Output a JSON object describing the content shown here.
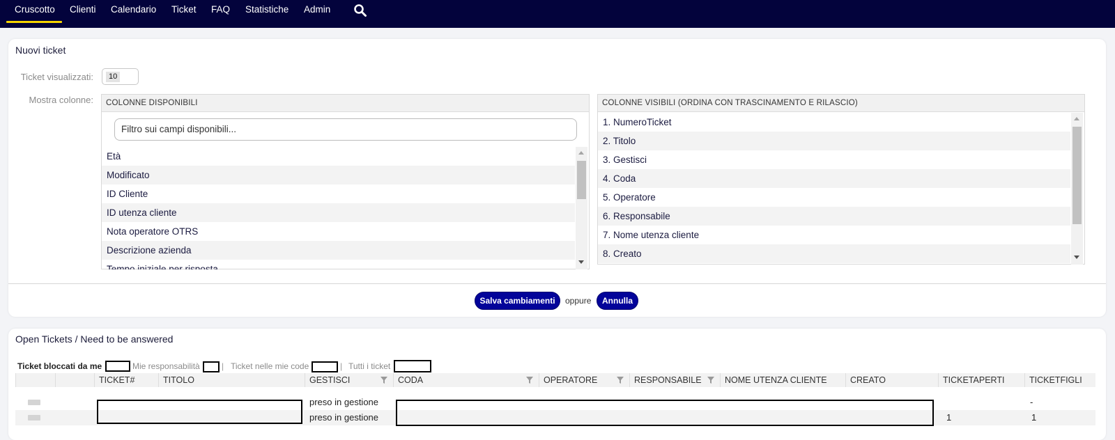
{
  "nav": {
    "items": [
      {
        "label": "Cruscotto",
        "active": true
      },
      {
        "label": "Clienti"
      },
      {
        "label": "Calendario"
      },
      {
        "label": "Ticket"
      },
      {
        "label": "FAQ"
      },
      {
        "label": "Statistiche"
      },
      {
        "label": "Admin"
      }
    ],
    "search_icon": "search-icon"
  },
  "new_tickets": {
    "title": "Nuovi ticket",
    "shown_label": "Ticket visualizzati:",
    "shown_value": "10",
    "columns_label": "Mostra colonne:",
    "available": {
      "header": "COLONNE DISPONIBILI",
      "filter_placeholder": "Filtro sui campi disponibili...",
      "items": [
        "Età",
        "Modificato",
        "ID Cliente",
        "ID utenza cliente",
        "Nota operatore OTRS",
        "Descrizione azienda",
        "Tempo iniziale per risposta"
      ]
    },
    "visible": {
      "header": "COLONNE VISIBILI (ORDINA CON TRASCINAMENTO E RILASCIO)",
      "items": [
        "1. NumeroTicket",
        "2. Titolo",
        "3. Gestisci",
        "4. Coda",
        "5. Operatore",
        "6. Responsabile",
        "7. Nome utenza cliente",
        "8. Creato"
      ]
    },
    "save_label": "Salva cambiamenti",
    "or_label": "oppure",
    "cancel_label": "Annulla"
  },
  "open_tickets": {
    "title": "Open Tickets / Need to be answered",
    "filters": [
      {
        "label": "Ticket bloccati da me",
        "active": true
      },
      {
        "label": "Mie responsabilità"
      },
      {
        "label": "Ticket nelle mie code"
      },
      {
        "label": "Tutti i ticket"
      }
    ],
    "separator": "|",
    "columns": [
      "TICKET#",
      "TITOLO",
      "GESTISCI",
      "CODA",
      "OPERATORE",
      "RESPONSABILE",
      "NOME UTENZA CLIENTE",
      "CREATO",
      "TICKETAPERTI",
      "TICKETFIGLI"
    ],
    "rows": [
      {
        "gestisci": "preso in gestione",
        "ticketaperti": "",
        "ticketfigli": "-"
      },
      {
        "gestisci": "preso in gestione",
        "ticketaperti": "1",
        "ticketfigli": "1"
      }
    ]
  },
  "colors": {
    "nav_bg": "#03033c",
    "active_underline": "#f5d400",
    "button_bg": "#03049a"
  }
}
